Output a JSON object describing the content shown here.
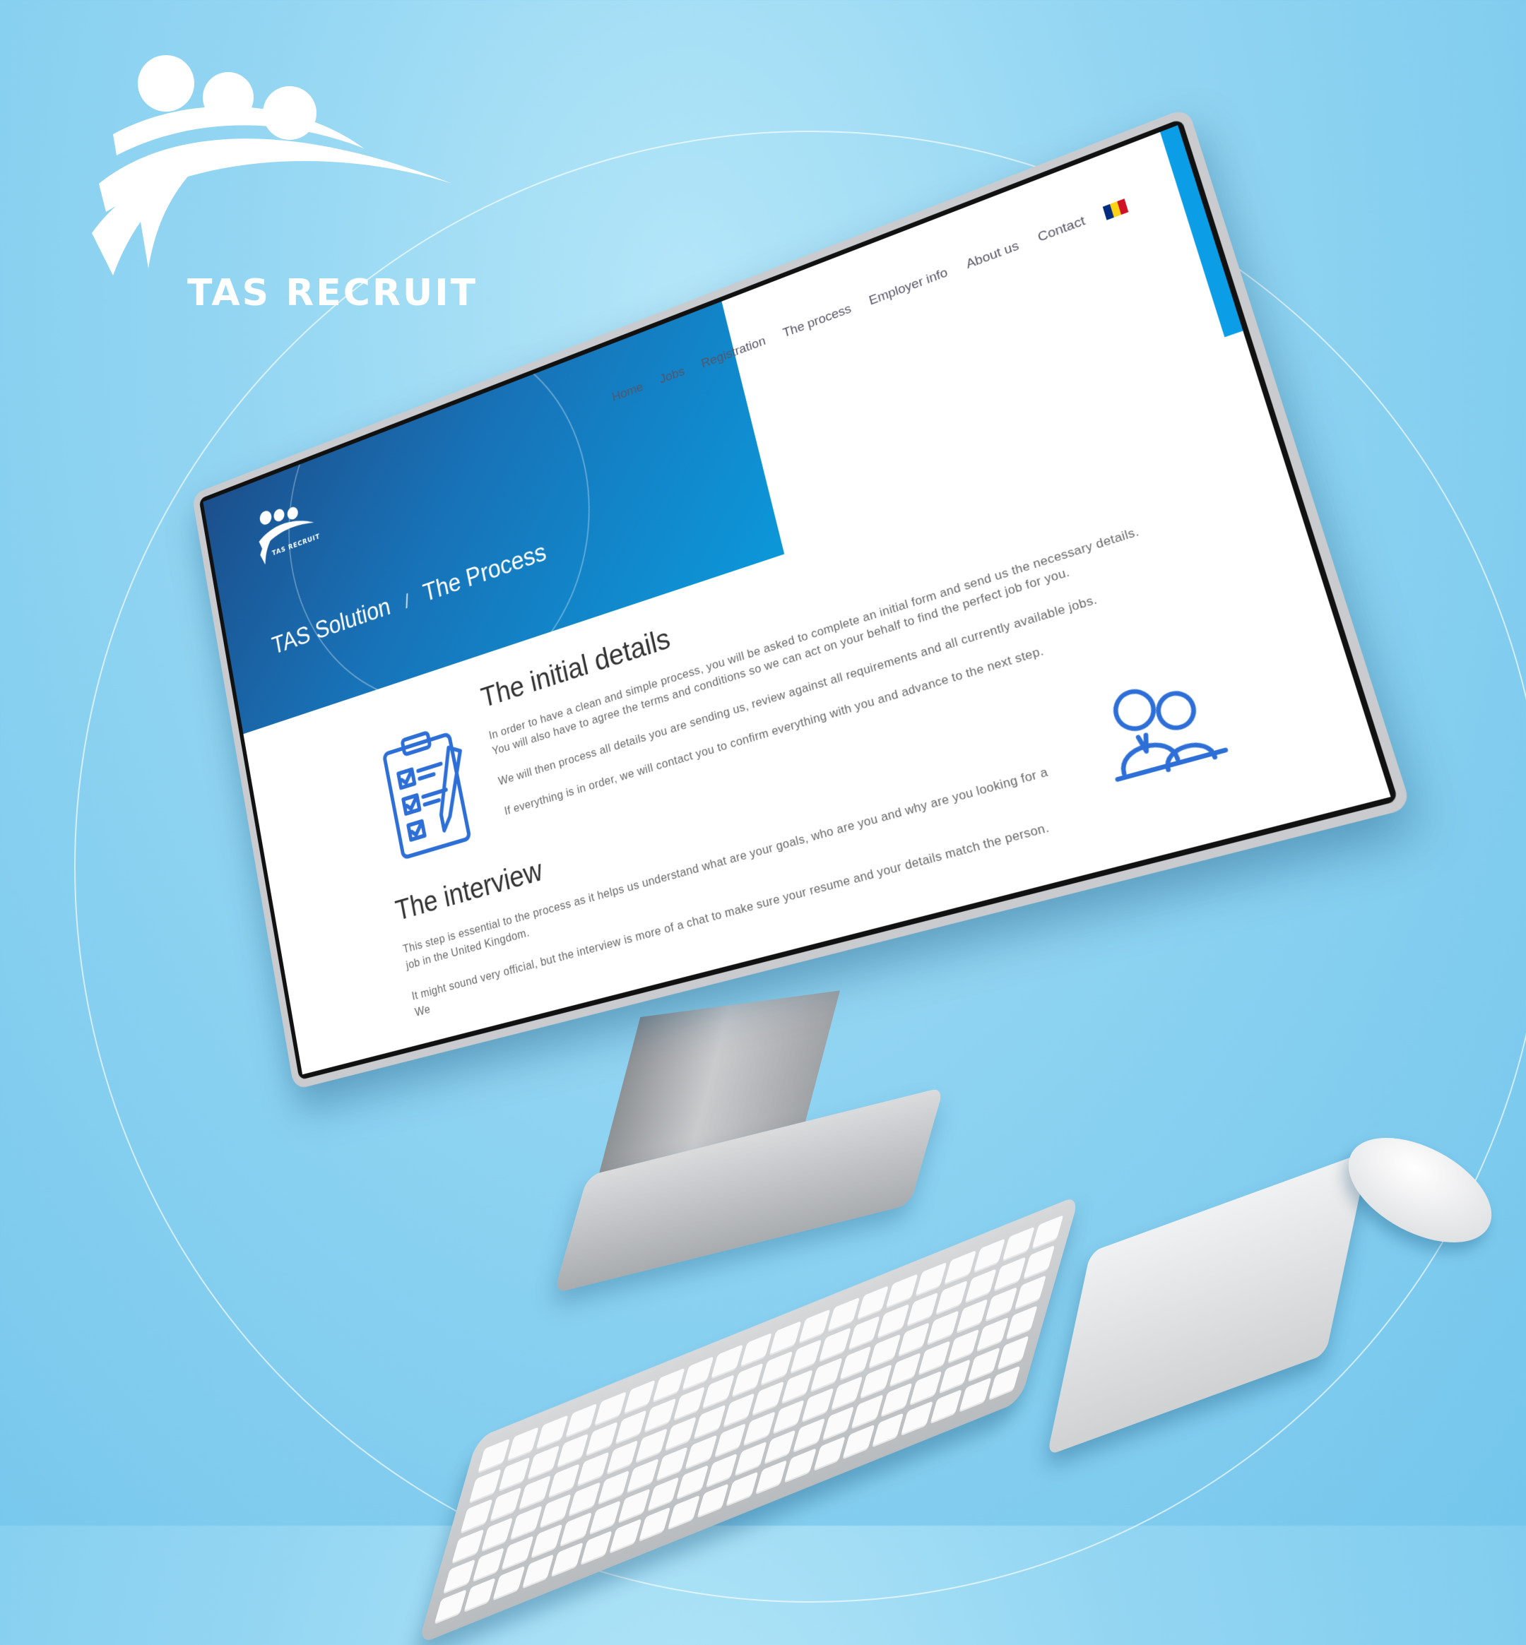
{
  "brand": {
    "name": "TAS RECRUIT"
  },
  "site": {
    "logo_text": "TAS RECRUIT",
    "nav": [
      "Home",
      "Jobs",
      "Registration",
      "The process",
      "Employer info",
      "About us",
      "Contact"
    ],
    "flag_colors": [
      "#002b7f",
      "#fcd116",
      "#ce1126"
    ],
    "breadcrumb": {
      "parent": "TAS Solution",
      "separator": "/",
      "current": "The Process"
    }
  },
  "sections": [
    {
      "title": "The initial details",
      "paragraphs": [
        "In order to have a clean and simple process, you will be asked to complete an initial form and send us the necessary details. You will also have to agree the terms and conditions so we can act on your behalf to find the perfect job for you.",
        "We will then process all details you are sending us, review against all requirements and all currently available jobs.",
        "If everything is in order, we will contact you to confirm everything with you and advance to the next step."
      ],
      "icon": "clipboard-checklist-icon"
    },
    {
      "title": "The interview",
      "paragraphs": [
        "This step is essential to the process as it helps us understand what are your goals, who are you and why are you looking for a job in the United Kingdom.",
        "It might sound very official, but the interview is more of a chat to make sure your resume and your details match the person. We"
      ],
      "icon": "interview-people-icon"
    }
  ],
  "colors": {
    "background": "#92d5f2",
    "hero_start": "#1c4f8c",
    "hero_end": "#0c97d9",
    "accent": "#0b9ee6",
    "icon": "#2d6fd6"
  }
}
